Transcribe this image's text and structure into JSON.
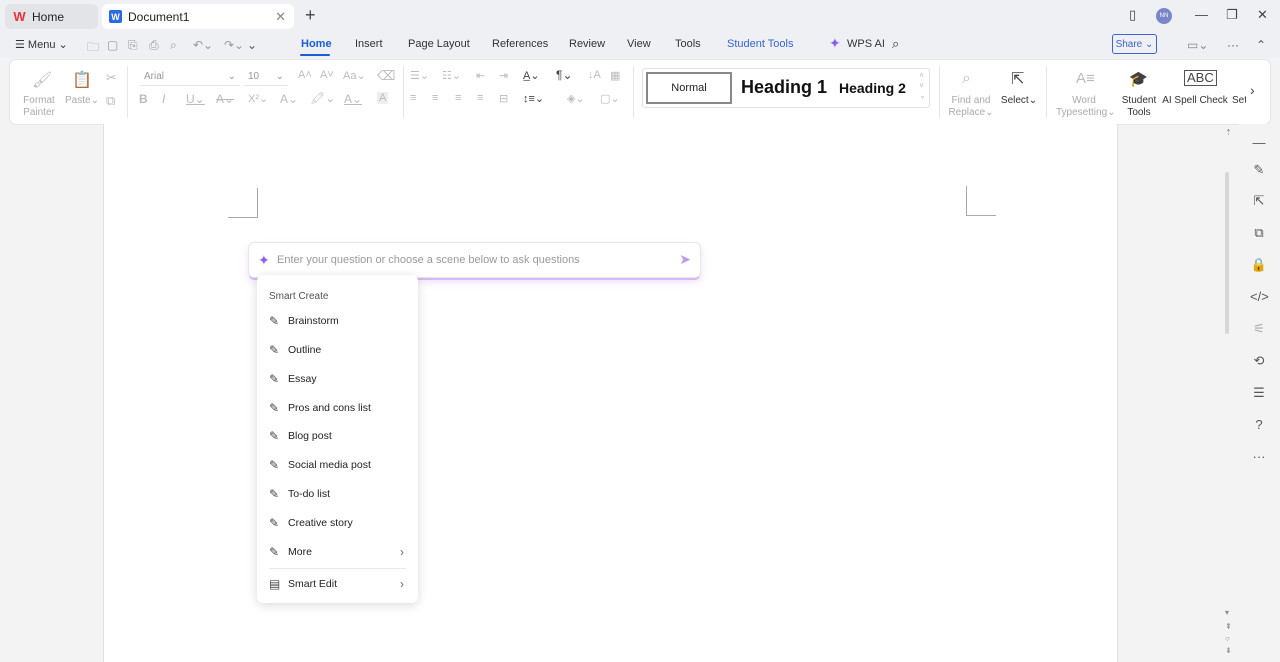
{
  "tabs": {
    "home": "Home",
    "document": "Document1",
    "avatar_initials": "NN"
  },
  "menu": {
    "menu_label": "Menu",
    "items": [
      "Home",
      "Insert",
      "Page Layout",
      "References",
      "Review",
      "View",
      "Tools",
      "Student Tools"
    ],
    "wps_ai": "WPS AI",
    "share": "Share"
  },
  "ribbon": {
    "format_painter": "Format Painter",
    "paste": "Paste",
    "font_name": "Arial",
    "font_size": "10",
    "styles": {
      "normal": "Normal",
      "heading1": "Heading 1",
      "heading2": "Heading 2"
    },
    "find_replace": "Find and Replace",
    "select": "Select",
    "word_typesetting": "Word Typesetting",
    "student_tools": "Student Tools",
    "ai_spell_check": "AI Spell Check",
    "settings_partial": "Set"
  },
  "ai_prompt": {
    "placeholder": "Enter your question or choose a scene below to ask questions"
  },
  "smart_create": {
    "heading": "Smart Create",
    "items": [
      "Brainstorm",
      "Outline",
      "Essay",
      "Pros and cons list",
      "Blog post",
      "Social media post",
      "To-do list",
      "Creative story",
      "More"
    ],
    "smart_edit": "Smart Edit"
  },
  "colors": {
    "accent": "#1a5ed6",
    "ai_purple": "#8b5cf6"
  }
}
